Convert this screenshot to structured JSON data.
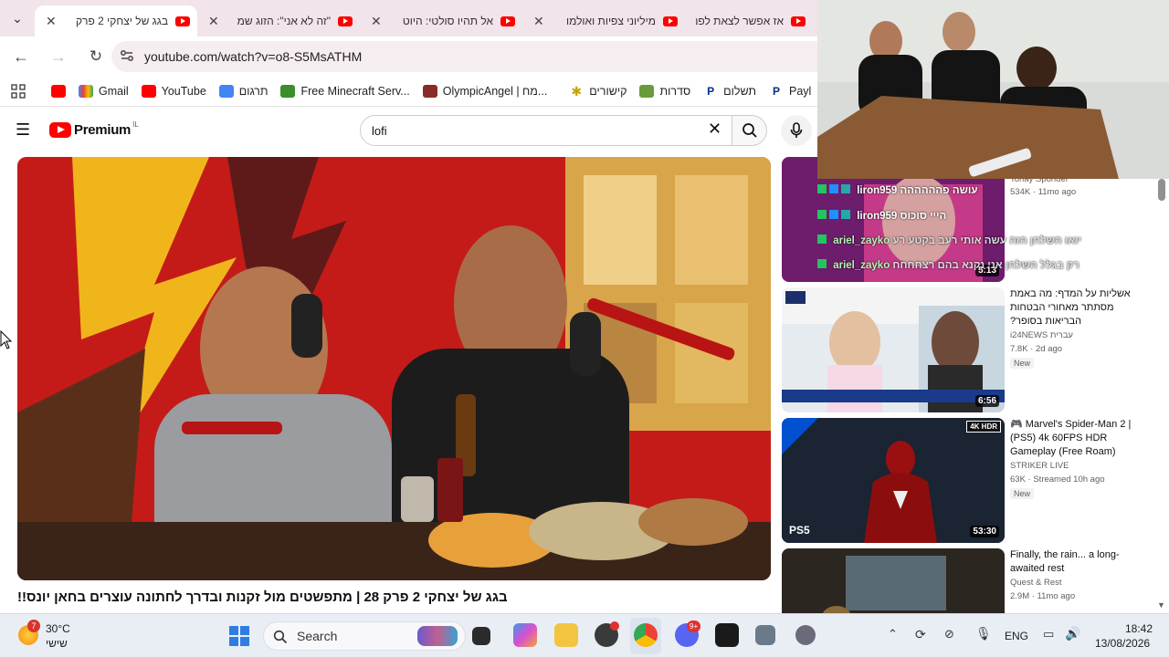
{
  "browser": {
    "tabs": [
      {
        "title": "בגג של יצחקי 2 פרק",
        "active": true
      },
      {
        "title": "\"זה לא אני\": הזוג שמ"
      },
      {
        "title": "אל תהיו סולטי: היוט"
      },
      {
        "title": "מיליוני צפיות ואולמו"
      },
      {
        "title": "אז אפשר לצאת לפנ"
      }
    ],
    "url": "youtube.com/watch?v=o8-S5MsATHM",
    "bookmarks": [
      {
        "label": "Gmail",
        "icon": "gmail-icon"
      },
      {
        "label": "YouTube",
        "icon": "youtube-icon"
      },
      {
        "label": "תרגום",
        "icon": "translate-icon"
      },
      {
        "label": "Free Minecraft Serv...",
        "icon": "minecraft-icon"
      },
      {
        "label": "OlympicAngel | מח...",
        "icon": "avatar-icon"
      },
      {
        "label": "קישורים",
        "icon": "star-icon"
      },
      {
        "label": "סדרות",
        "icon": "folder-icon"
      },
      {
        "label": "תשלום",
        "icon": "paypal-icon"
      },
      {
        "label": "Payl",
        "icon": "paypal-icon"
      }
    ]
  },
  "youtube": {
    "logo_text": "Premium",
    "country_code": "IL",
    "search_query": "lofi",
    "video_title": "בגג של יצחקי 2 פרק 28 | מתפשטים מול זקנות ובדרך לחתונה עוצרים בחאן יונס!!",
    "recommendations": [
      {
        "title": "",
        "channel": "Tonay Sponder",
        "meta": "534K · 11mo ago",
        "duration": "5:13"
      },
      {
        "title": "אשליות על המדף: מה באמת מסתתר מאחורי הבטחות הבריאות בסופר?",
        "channel": "i24NEWS עברית",
        "meta": "7.8K · 2d ago",
        "badge": "New",
        "duration": "6:56"
      },
      {
        "title": "🎮 Marvel's Spider-Man 2 | (PS5) 4k 60FPS HDR Gameplay (Free Roam)",
        "channel": "STRIKER LIVE",
        "meta": "63K · Streamed 10h ago",
        "badge": "New",
        "duration": "53:30",
        "thumb_badge": "4K HDR",
        "thumb_logo": "PS5"
      },
      {
        "title": "Finally, the rain... a long-awaited rest",
        "channel": "Quest & Rest",
        "meta": "2.9M · 11mo ago",
        "duration": ""
      }
    ]
  },
  "chat_overlay": [
    {
      "user": "liron959",
      "message": "עושה פהההההה",
      "user_color": "#ffffff"
    },
    {
      "user": "liron959",
      "message": "הייי סוכוס",
      "user_color": "#ffffff"
    },
    {
      "user": "ariel_zayko",
      "message": "יואו השלחן הזה עשה אותי רעב בקטע רע",
      "user_color": "#b4f3b4"
    },
    {
      "user": "ariel_zayko",
      "message": "רק בגלל השלחן אני נקנא בהם רצחחחח",
      "user_color": "#b4f3b4"
    }
  ],
  "taskbar": {
    "weather_temp": "30°C",
    "weather_day": "שישי",
    "weather_badge": "7",
    "search_placeholder": "Search",
    "language": "ENG",
    "time": "18:42",
    "date": "13/08/2026",
    "discord_badge": "9+"
  },
  "colors": {
    "youtube_red": "#ff0000",
    "tabstrip_bg": "#f1e4ea",
    "taskbar_bg": "#e9eef5"
  }
}
